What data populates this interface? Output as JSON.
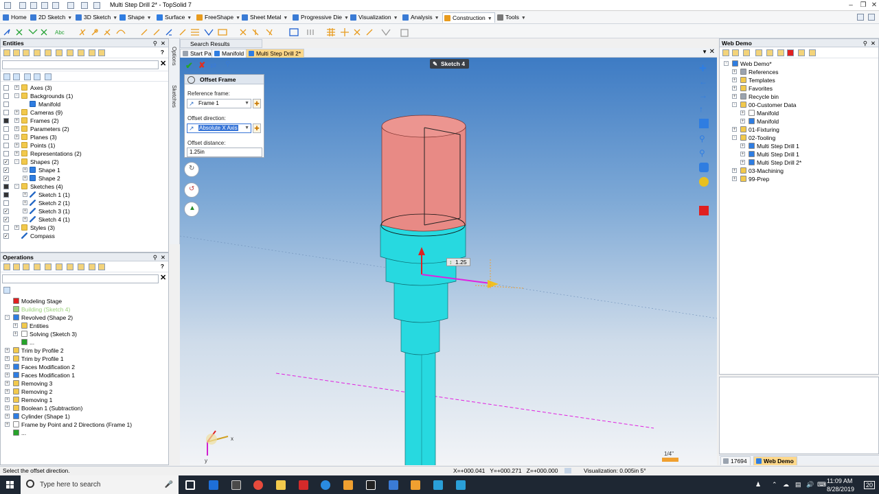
{
  "window": {
    "title": "Multi Step Drill 2* - TopSolid 7"
  },
  "ribbon": {
    "tabs": [
      {
        "label": "Home",
        "color": "#3a7bd5"
      },
      {
        "label": "2D Sketch",
        "color": "#3a7bd5"
      },
      {
        "label": "3D Sketch",
        "color": "#3a7bd5"
      },
      {
        "label": "Shape",
        "color": "#2f7de1"
      },
      {
        "label": "Surface",
        "color": "#2f7de1"
      },
      {
        "label": "FreeShape",
        "color": "#e89b1e"
      },
      {
        "label": "Sheet Metal",
        "color": "#3a7bd5"
      },
      {
        "label": "Progressive Die",
        "color": "#3a7bd5"
      },
      {
        "label": "Visualization",
        "color": "#3a7bd5"
      },
      {
        "label": "Analysis",
        "color": "#3a7bd5"
      },
      {
        "label": "Construction",
        "color": "#e89b1e"
      },
      {
        "label": "Tools",
        "color": "#777777"
      }
    ],
    "active_tab": "Construction"
  },
  "entities": {
    "title": "Entities",
    "rows": [
      {
        "label": "Axes (3)",
        "icon": "folder-icon"
      },
      {
        "label": "Backgrounds (1)",
        "icon": "folder-icon"
      },
      {
        "label": "Manifold",
        "icon": "part-icon"
      },
      {
        "label": "Cameras (9)",
        "icon": "folder-icon"
      },
      {
        "label": "Frames (2)",
        "icon": "folder-icon"
      },
      {
        "label": "Parameters (2)",
        "icon": "folder-icon"
      },
      {
        "label": "Planes (3)",
        "icon": "folder-icon"
      },
      {
        "label": "Points (1)",
        "icon": "folder-icon"
      },
      {
        "label": "Representations (2)",
        "icon": "folder-icon"
      },
      {
        "label": "Shapes (2)",
        "icon": "folder-icon"
      },
      {
        "label": "Shape 1",
        "icon": "shape-icon"
      },
      {
        "label": "Shape 2",
        "icon": "shape-icon"
      },
      {
        "label": "Sketches (4)",
        "icon": "folder-icon"
      },
      {
        "label": "Sketch 1 (1)",
        "icon": "sketch-icon"
      },
      {
        "label": "Sketch 2 (1)",
        "icon": "sketch-icon"
      },
      {
        "label": "Sketch 3 (1)",
        "icon": "sketch-icon"
      },
      {
        "label": "Sketch 4 (1)",
        "icon": "sketch-icon"
      },
      {
        "label": "Styles (3)",
        "icon": "folder-icon"
      },
      {
        "label": "Compass",
        "icon": "compass-icon"
      }
    ]
  },
  "operations": {
    "title": "Operations",
    "rows": [
      {
        "label": "Modeling Stage"
      },
      {
        "label": "Building (Sketch 4)"
      },
      {
        "label": "Revolved (Shape 2)"
      },
      {
        "label": "Entities"
      },
      {
        "label": "Solving (Sketch 3)"
      },
      {
        "label": "..."
      },
      {
        "label": "Trim by Profile 2"
      },
      {
        "label": "Trim by Profile 1"
      },
      {
        "label": "Faces Modification 2"
      },
      {
        "label": "Faces Modification 1"
      },
      {
        "label": "Removing 3"
      },
      {
        "label": "Removing 2"
      },
      {
        "label": "Removing 1"
      },
      {
        "label": "Boolean 1 (Subtraction)"
      },
      {
        "label": "Cylinder (Shape 1)"
      },
      {
        "label": "Frame by Point and 2 Directions (Frame 1)"
      },
      {
        "label": "..."
      }
    ]
  },
  "side_strip": {
    "options": "Options",
    "sketches": "Sketches"
  },
  "doc_tabs": {
    "search": "Search Results",
    "tabs": [
      "Start Page",
      "Manifold",
      "Multi Step Drill 2*"
    ],
    "active": "Multi Step Drill 2*"
  },
  "dialog": {
    "title": "Offset Frame",
    "reference_frame_label": "Reference frame:",
    "reference_frame_value": "Frame 1",
    "offset_direction_label": "Offset direction:",
    "offset_direction_value": "Absolute X Axis",
    "offset_distance_label": "Offset distance:",
    "offset_distance_value": "1.25in"
  },
  "viewport": {
    "sketch_label": "Sketch 4",
    "dim_label": "1.25",
    "scale_label": "1/4\"",
    "axis_x": "x",
    "axis_y": "y",
    "colors": {
      "cap": "#e88a85",
      "body": "#27d9e0",
      "bg_top": "#3d7bc4"
    }
  },
  "web_demo": {
    "title": "Web Demo",
    "rows": [
      {
        "label": "Web Demo*"
      },
      {
        "label": "References"
      },
      {
        "label": "Templates"
      },
      {
        "label": "Favorites"
      },
      {
        "label": "Recycle bin"
      },
      {
        "label": "00-Customer Data"
      },
      {
        "label": "Manifold"
      },
      {
        "label": "Manifold"
      },
      {
        "label": "01-Fixturing"
      },
      {
        "label": "02-Tooling"
      },
      {
        "label": "Multi Step Drill 1"
      },
      {
        "label": "Multi Step Drill 1"
      },
      {
        "label": "Multi Step Drill 2*"
      },
      {
        "label": "03-Machining"
      },
      {
        "label": "99-Prep"
      }
    ],
    "bottom_tabs": [
      "17694",
      "Web Demo"
    ]
  },
  "status": {
    "message": "Select the offset direction.",
    "coords": "X=+000.041   Y=+000.271   Z=+000.000",
    "visualization": "Visualization: 0.005in 5°"
  },
  "taskbar": {
    "search_placeholder": "Type here to search",
    "time": "11:09 AM",
    "date": "8/28/2019",
    "notif": "20"
  }
}
